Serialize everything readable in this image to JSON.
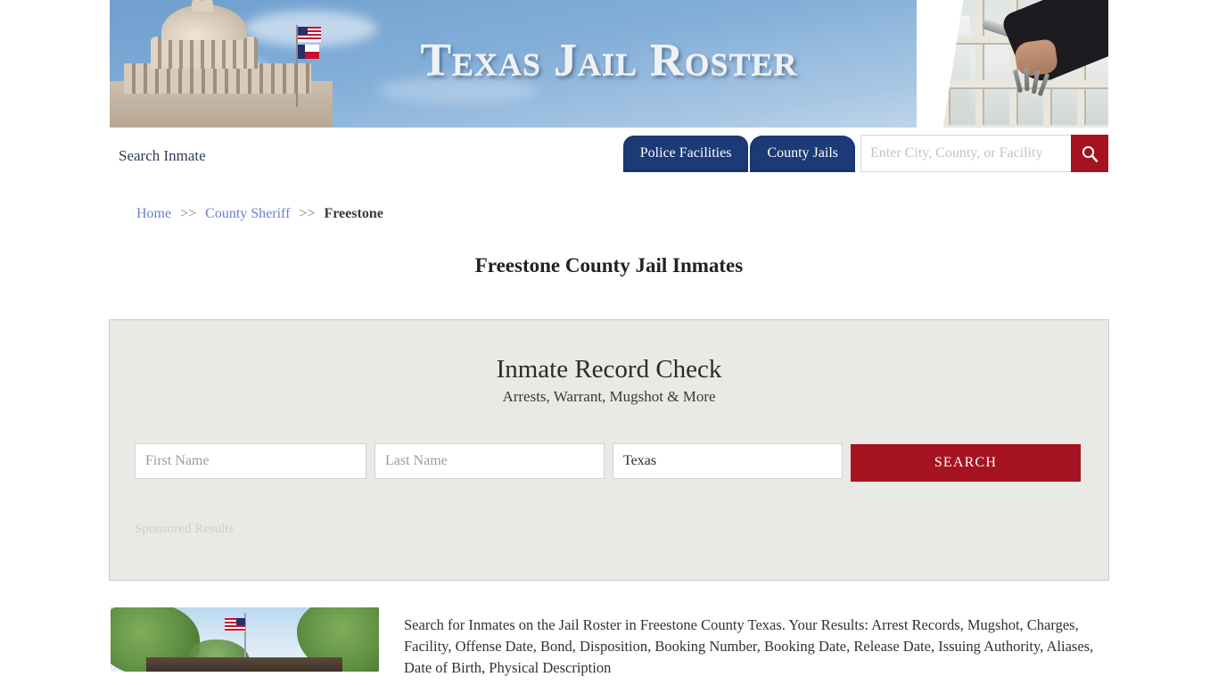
{
  "banner": {
    "title": "Texas Jail Roster",
    "left_image": "texas-capitol-dome-photo",
    "right_image": "jail-door-hand-with-keys-photo"
  },
  "nav": {
    "brand": "Search Inmate",
    "tabs": [
      {
        "label": "Police Facilities"
      },
      {
        "label": "County Jails"
      }
    ],
    "search": {
      "placeholder": "Enter City, County, or Facility",
      "value": "",
      "button_icon": "search-icon"
    }
  },
  "breadcrumb": {
    "home": "Home",
    "sep1": ">>",
    "county_sheriff": "County Sheriff",
    "sep2": ">>",
    "current": "Freestone"
  },
  "page_title": "Freestone County Jail Inmates",
  "panel": {
    "heading": "Inmate Record Check",
    "subheading": "Arrests, Warrant, Mugshot & More",
    "first_name_placeholder": "First Name",
    "first_name_value": "",
    "last_name_placeholder": "Last Name",
    "last_name_value": "",
    "state_selected": "Texas",
    "state_options": [
      "Texas"
    ],
    "search_button": "SEARCH",
    "sponsored_label": "Sponsored Results"
  },
  "content": {
    "thumbnail_alt": "freestone-county-courthouse-photo",
    "paragraph": "Search for Inmates on the Jail Roster in Freestone County Texas. Your Results: Arrest Records, Mugshot, Charges, Facility, Offense Date, Bond, Disposition, Booking Number, Booking Date, Release Date, Issuing Authority, Aliases, Date of Birth, Physical Description"
  },
  "colors": {
    "brand_navy": "#1b3a76",
    "accent_red": "#a61320",
    "link_blue": "#6a7fd0",
    "panel_bg": "#e9e9e5",
    "panel_border": "#c9c9c5"
  }
}
